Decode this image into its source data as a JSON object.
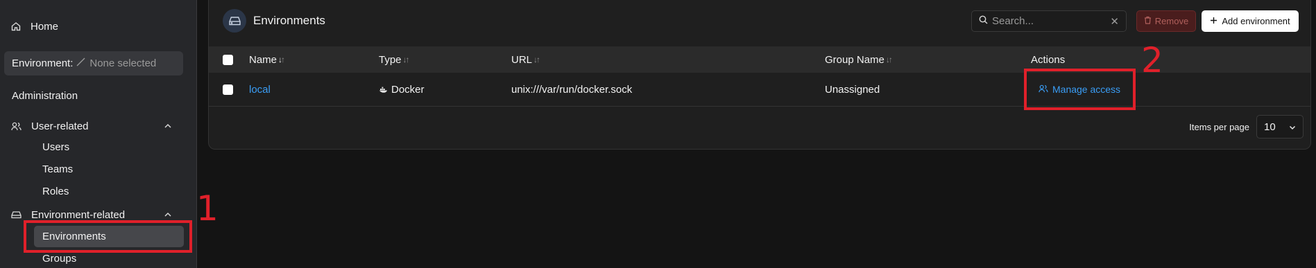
{
  "sidebar": {
    "home_label": "Home",
    "environment_label": "Environment:",
    "environment_value": "None selected",
    "section_title": "Administration",
    "user_related": {
      "label": "User-related",
      "items": [
        "Users",
        "Teams",
        "Roles"
      ]
    },
    "environment_related": {
      "label": "Environment-related",
      "items": [
        "Environments",
        "Groups"
      ]
    }
  },
  "main": {
    "title": "Environments",
    "search": {
      "placeholder": "Search...",
      "value": ""
    },
    "remove_label": "Remove",
    "add_label": "Add environment",
    "columns": [
      "Name",
      "Type",
      "URL",
      "Group Name",
      "Actions"
    ],
    "rows": [
      {
        "name": "local",
        "type": "Docker",
        "url": "unix:///var/run/docker.sock",
        "group": "Unassigned",
        "action": "Manage access"
      }
    ],
    "items_per_page_label": "Items per page",
    "items_per_page_value": "10"
  },
  "annotations": [
    "1",
    "2"
  ],
  "colors": {
    "accent": "#3a9df5",
    "annotation": "#e0202a",
    "remove_bg": "#4a1d1d"
  }
}
